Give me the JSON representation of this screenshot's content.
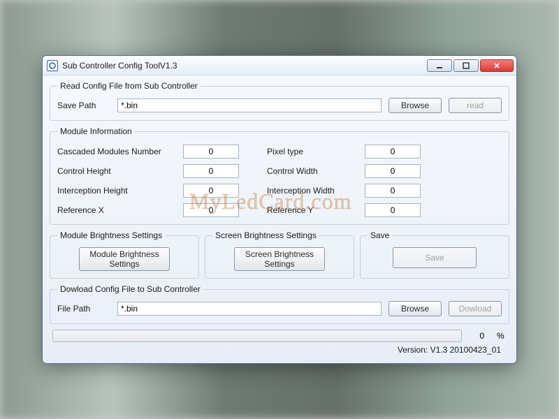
{
  "window": {
    "title": "Sub Controller Config ToolV1.3"
  },
  "read_section": {
    "legend": "Read Config File from Sub Controller",
    "save_path_label": "Save Path",
    "save_path_value": "*.bin",
    "browse_label": "Browse",
    "read_label": "read"
  },
  "module_info": {
    "legend": "Module Information",
    "rows": [
      {
        "l": "Cascaded Modules Number",
        "lv": "0",
        "r": "Pixel  type",
        "rv": "0"
      },
      {
        "l": "Control Height",
        "lv": "0",
        "r": "Control Width",
        "rv": "0"
      },
      {
        "l": "Interception Height",
        "lv": "0",
        "r": "Interception Width",
        "rv": "0"
      },
      {
        "l": "Reference X",
        "lv": "0",
        "r": "Reference Y",
        "rv": "0"
      }
    ]
  },
  "brightness": {
    "module_legend": "Module Brightness Settings",
    "module_button": "Module Brightness\nSettings",
    "screen_legend": "Screen Brightness Settings",
    "screen_button": "Screen Brightness\nSettings",
    "save_legend": "Save",
    "save_button": "Save"
  },
  "download_section": {
    "legend": "Dowload Config File to Sub Controller",
    "file_path_label": "File Path",
    "file_path_value": "*.bin",
    "browse_label": "Browse",
    "download_label": "Dowload"
  },
  "progress": {
    "value": "0",
    "symbol": "%"
  },
  "version": "Version: V1.3 20100423_01",
  "watermark": "MyLedCard.com"
}
